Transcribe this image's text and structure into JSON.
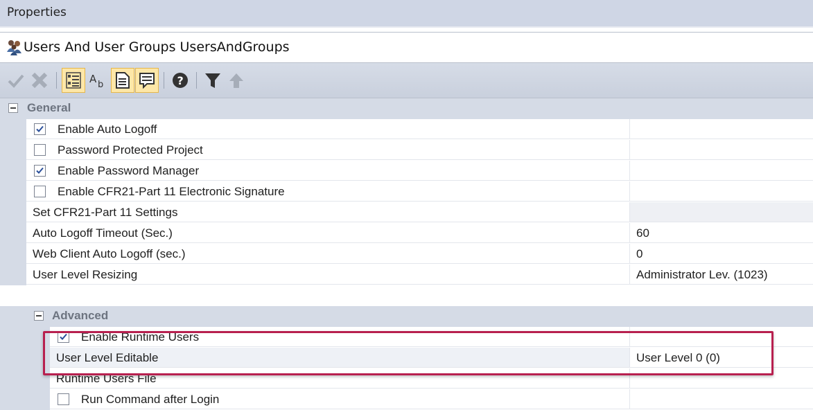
{
  "panel": {
    "title": "Properties"
  },
  "object": {
    "title": "Users And User Groups UsersAndGroups"
  },
  "toolbar": {
    "buttons": [
      {
        "icon": "checkmark-icon"
      },
      {
        "icon": "delete-x-icon"
      },
      {
        "icon": "categorized-view-icon",
        "active": true
      },
      {
        "icon": "alphabetical-sort-icon"
      },
      {
        "icon": "property-pages-icon",
        "active": true
      },
      {
        "icon": "description-panel-icon",
        "active": true
      },
      {
        "icon": "help-icon"
      },
      {
        "icon": "filter-icon"
      },
      {
        "icon": "arrow-up-icon"
      }
    ]
  },
  "categories": {
    "general": "General",
    "advanced": "Advanced"
  },
  "general_rows": [
    {
      "label": "Enable Auto Logoff",
      "checkbox": true,
      "checked": true,
      "value": ""
    },
    {
      "label": "Password Protected Project",
      "checkbox": true,
      "checked": false,
      "value": ""
    },
    {
      "label": "Enable Password Manager",
      "checkbox": true,
      "checked": true,
      "value": ""
    },
    {
      "label": "Enable CFR21-Part 11 Electronic Signature",
      "checkbox": true,
      "checked": false,
      "value": ""
    },
    {
      "label": "Set CFR21-Part 11 Settings",
      "checkbox": false,
      "value": ""
    },
    {
      "label": "Auto Logoff Timeout (Sec.)",
      "checkbox": false,
      "value": "60"
    },
    {
      "label": "Web Client Auto Logoff (sec.)",
      "checkbox": false,
      "value": "0"
    },
    {
      "label": "User Level Resizing",
      "checkbox": false,
      "value": "Administrator Lev. (1023)"
    }
  ],
  "advanced_rows": [
    {
      "label": "Enable Runtime Users",
      "checkbox": true,
      "checked": true,
      "value": ""
    },
    {
      "label": "User Level Editable",
      "checkbox": false,
      "value": "User Level 0 (0)"
    },
    {
      "label": "Runtime Users File",
      "checkbox": false,
      "value": ""
    },
    {
      "label": "Run Command after Login",
      "checkbox": true,
      "checked": false,
      "value": ""
    }
  ],
  "colors": {
    "highlight_border": "#b8204f",
    "category_bg": "#d5dbe6",
    "active_button": "#fde7a8"
  }
}
